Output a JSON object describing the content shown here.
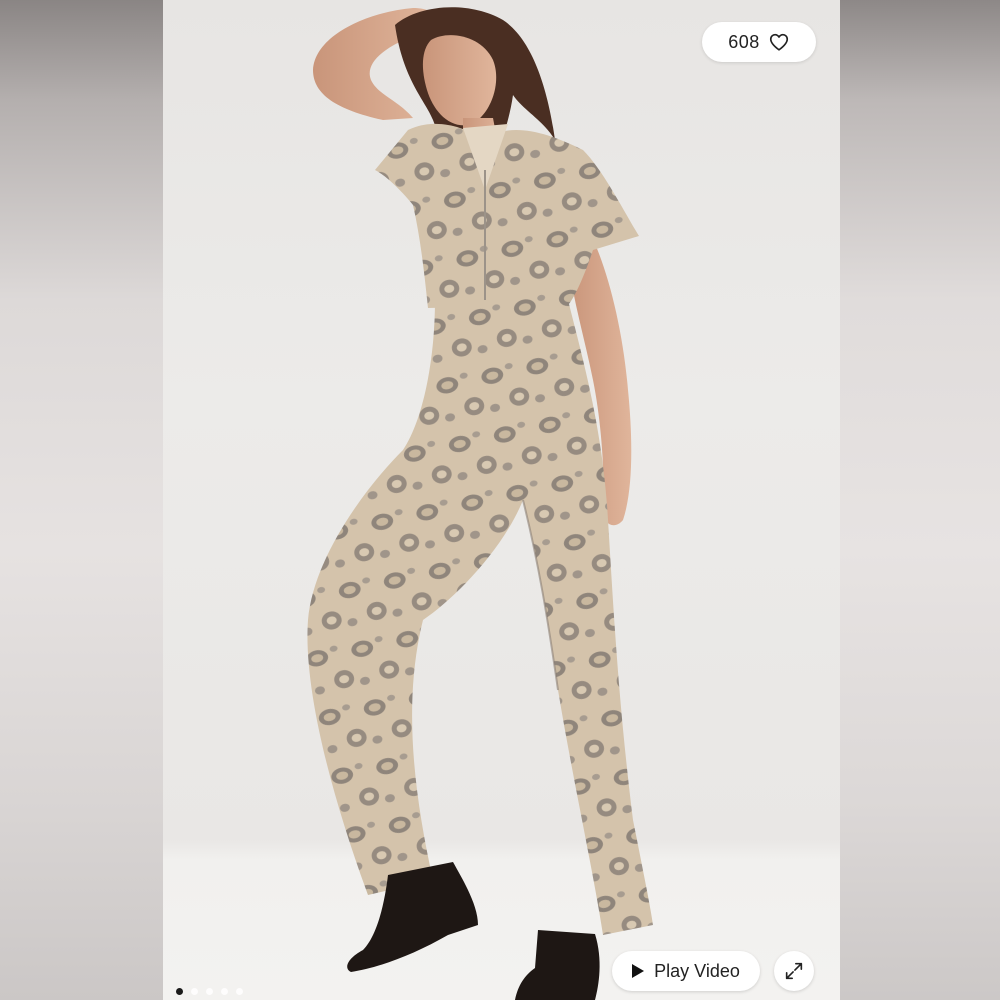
{
  "gallery": {
    "like_count": "608",
    "play_video_label": "Play Video",
    "total_slides": 5,
    "active_slide": 1
  },
  "icons": {
    "like": "heart-outline-icon",
    "play": "play-icon",
    "expand": "expand-icon"
  },
  "colors": {
    "button_bg": "#ffffff",
    "text": "#222222",
    "active_dot": "#1a1a1a",
    "inactive_dot": "#ffffff"
  }
}
